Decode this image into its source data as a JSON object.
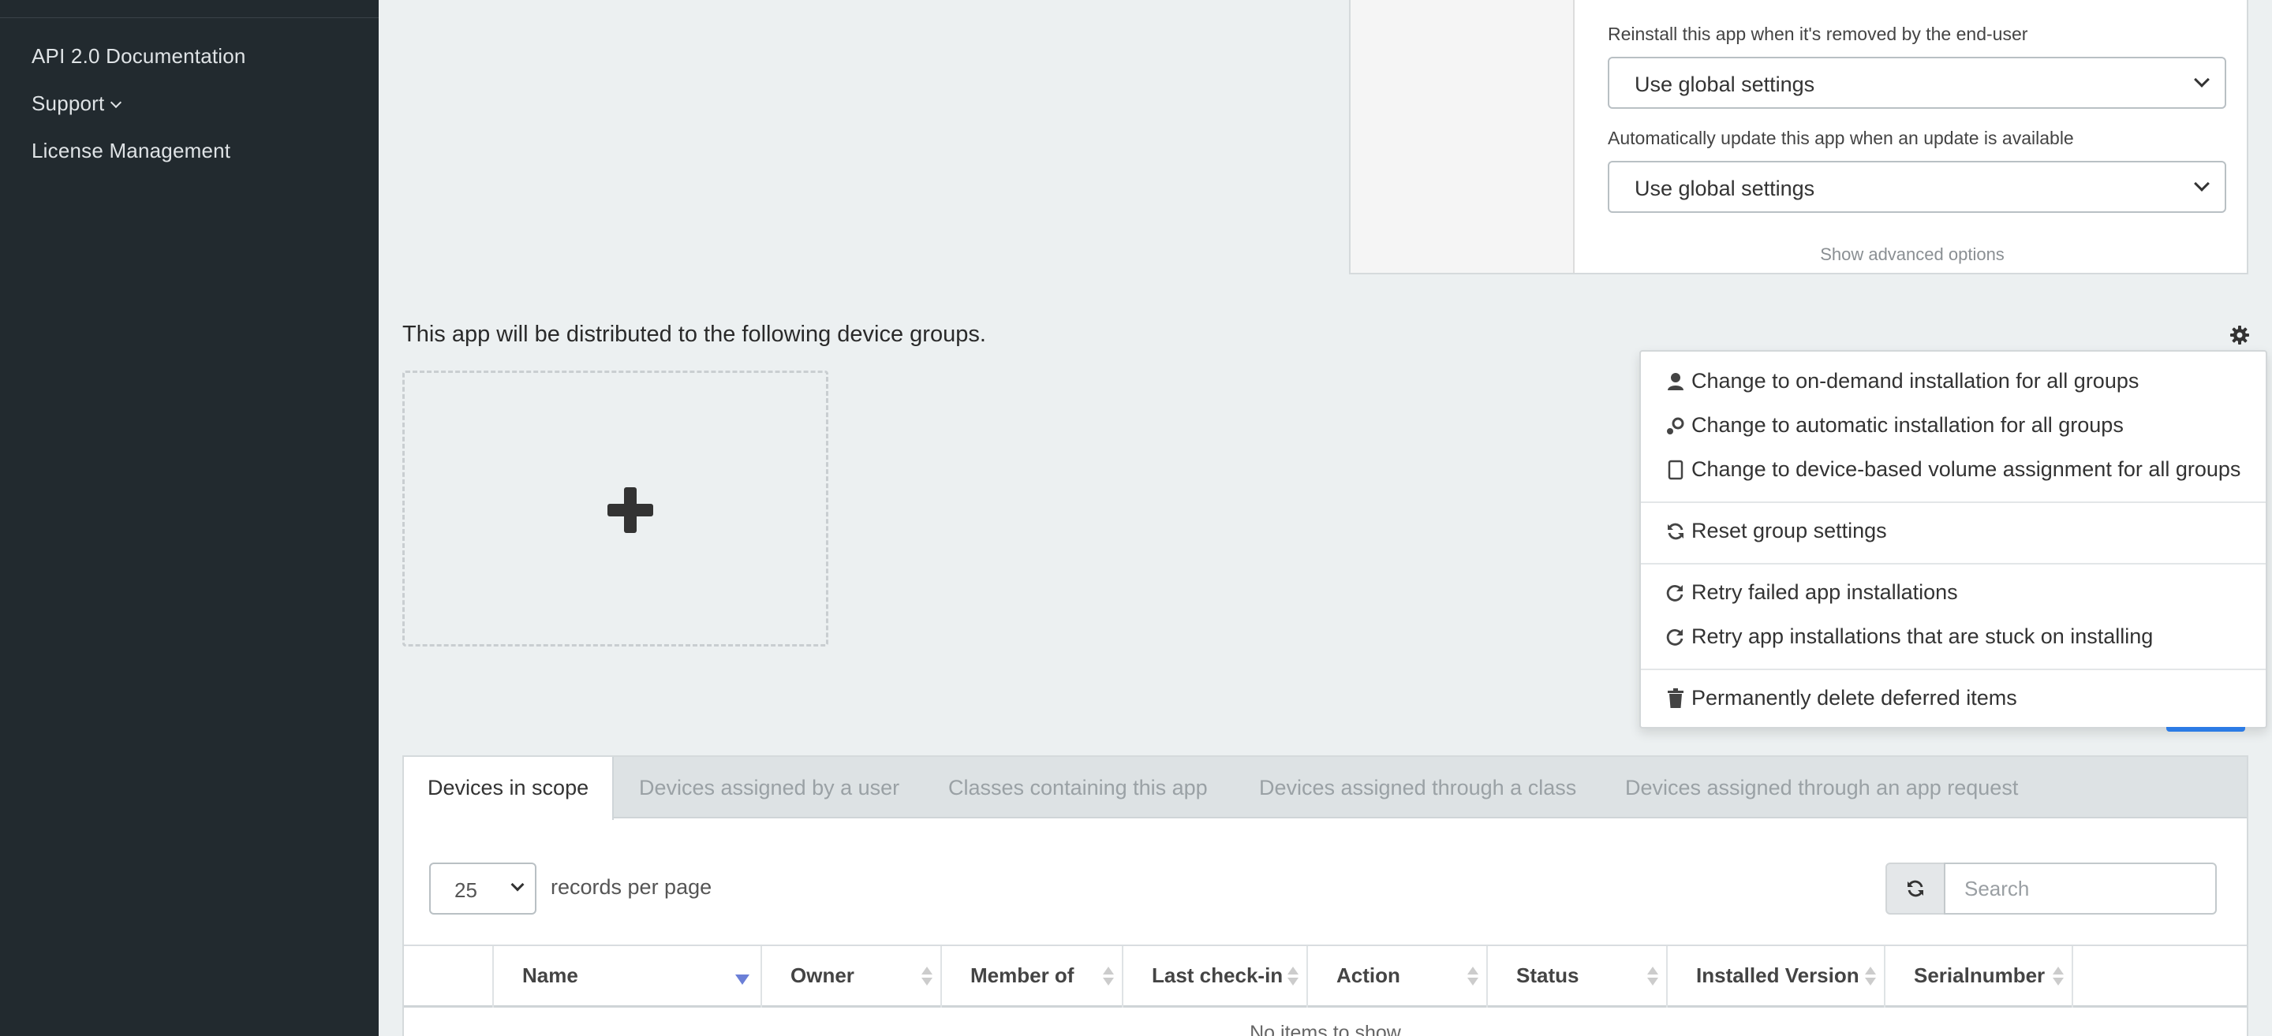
{
  "sidebar": {
    "items": [
      {
        "label": "API 2.0 Documentation"
      },
      {
        "label": "Support"
      },
      {
        "label": "License Management"
      }
    ]
  },
  "settings": {
    "reinstall_label": "Reinstall this app when it's removed by the end-user",
    "reinstall_value": "Use global settings",
    "auto_update_label": "Automatically update this app when an update is available",
    "auto_update_value": "Use global settings",
    "show_advanced": "Show advanced options"
  },
  "groups": {
    "title": "This app will be distributed to the following device groups."
  },
  "menu": {
    "items": [
      {
        "label": "Change to on-demand installation for all groups",
        "icon": "user-icon"
      },
      {
        "label": "Change to automatic installation for all groups",
        "icon": "auto-install-icon"
      },
      {
        "label": "Change to device-based volume assignment for all groups",
        "icon": "device-icon"
      },
      {
        "label": "Reset group settings",
        "icon": "refresh-icon"
      },
      {
        "label": "Retry failed app installations",
        "icon": "redo-icon"
      },
      {
        "label": "Retry app installations that are stuck on installing",
        "icon": "redo-icon"
      },
      {
        "label": "Permanently delete deferred items",
        "icon": "trash-icon"
      }
    ]
  },
  "tabs": [
    {
      "label": "Devices in scope",
      "active": true
    },
    {
      "label": "Devices assigned by a user"
    },
    {
      "label": "Classes containing this app"
    },
    {
      "label": "Devices assigned through a class"
    },
    {
      "label": "Devices assigned through an app request"
    }
  ],
  "table": {
    "records_per_page_value": "25",
    "records_per_page_label": "records per page",
    "search_placeholder": "Search",
    "columns": [
      "Name",
      "Owner",
      "Member of",
      "Last check-in",
      "Action",
      "Status",
      "Installed Version",
      "Serialnumber"
    ],
    "empty_text": "No items to show"
  },
  "colors": {
    "sidebar_bg": "#222a2f",
    "page_bg": "#ecf0f1",
    "accent": "#2c7be5",
    "sort_active": "#6b7fd7"
  }
}
